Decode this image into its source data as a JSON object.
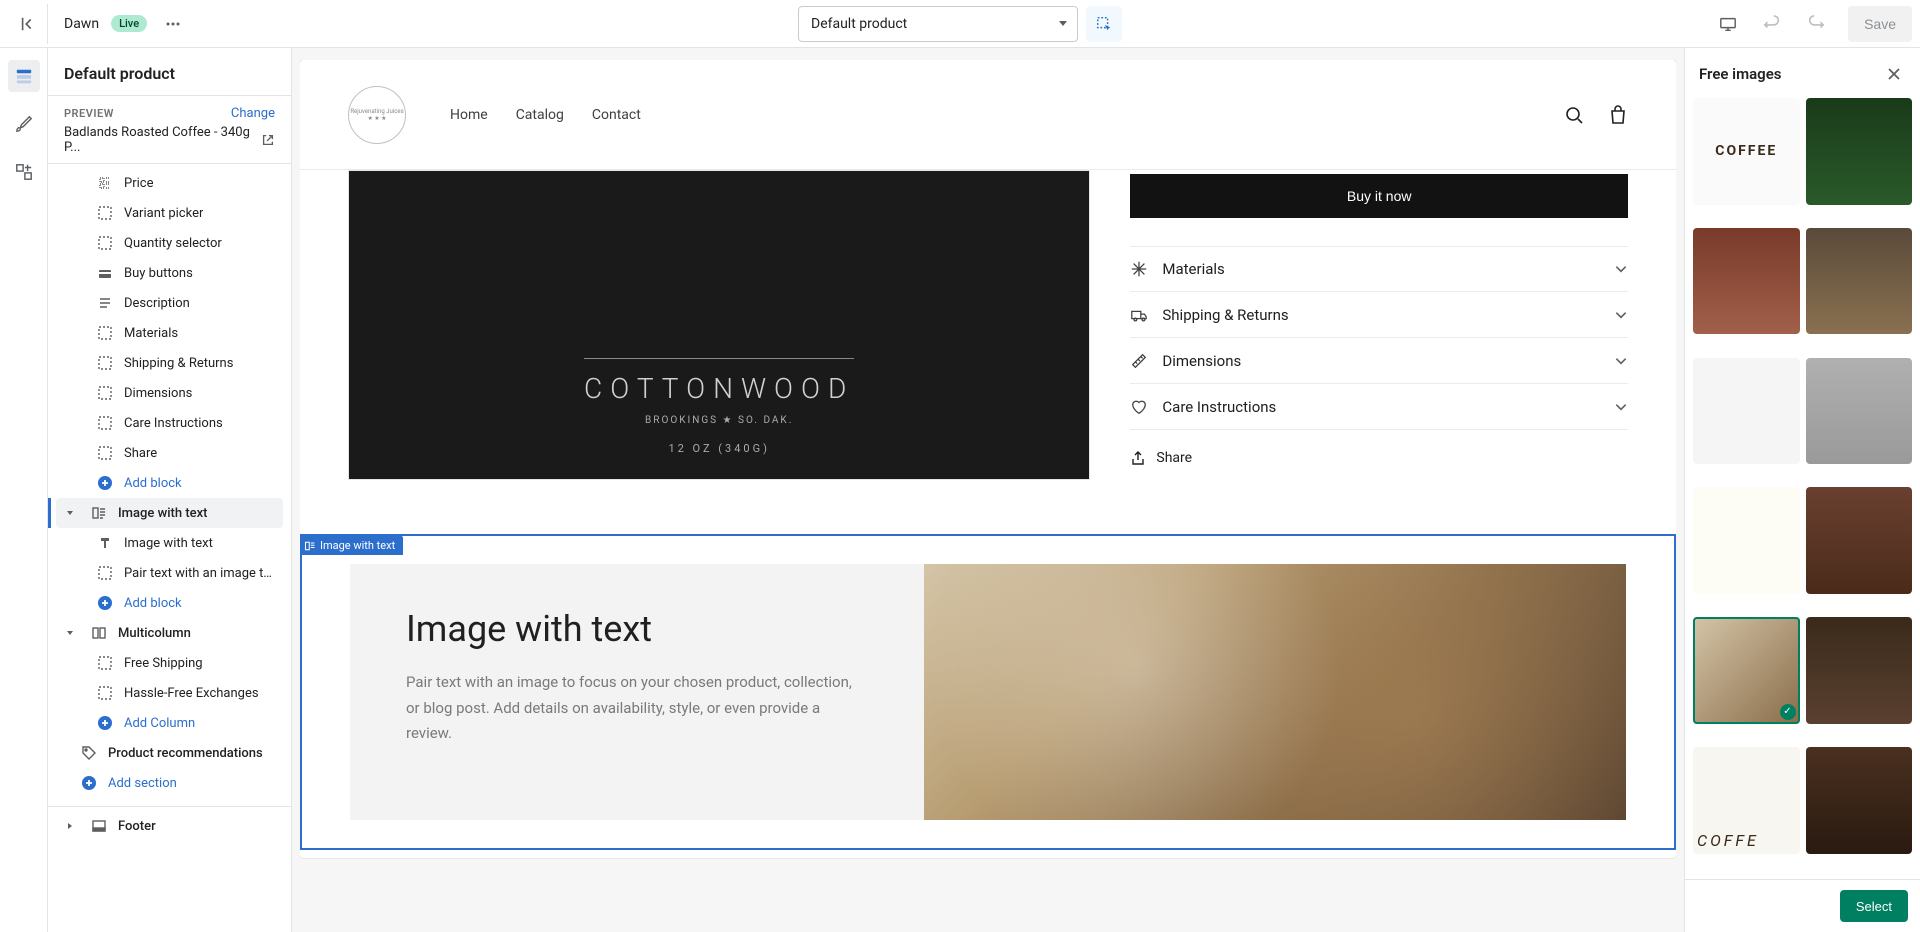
{
  "topbar": {
    "theme_name": "Dawn",
    "live_badge": "Live",
    "template_label": "Default product",
    "save_label": "Save"
  },
  "sidebar": {
    "title": "Default product",
    "preview_label": "PREVIEW",
    "change_label": "Change",
    "preview_product": "Badlands Roasted Coffee - 340g P...",
    "items": [
      {
        "label": "Price",
        "icon": "block"
      },
      {
        "label": "Variant picker",
        "icon": "block"
      },
      {
        "label": "Quantity selector",
        "icon": "block"
      },
      {
        "label": "Buy buttons",
        "icon": "buy"
      },
      {
        "label": "Description",
        "icon": "text"
      },
      {
        "label": "Materials",
        "icon": "block"
      },
      {
        "label": "Shipping & Returns",
        "icon": "block"
      },
      {
        "label": "Dimensions",
        "icon": "block"
      },
      {
        "label": "Care Instructions",
        "icon": "block"
      },
      {
        "label": "Share",
        "icon": "block"
      }
    ],
    "add_block": "Add block",
    "image_with_text": {
      "section": "Image with text",
      "children": [
        {
          "label": "Image with text",
          "icon": "heading"
        },
        {
          "label": "Pair text with an image to f...",
          "icon": "block"
        }
      ],
      "add_block": "Add block"
    },
    "multicolumn": {
      "section": "Multicolumn",
      "children": [
        {
          "label": "Free Shipping",
          "icon": "block"
        },
        {
          "label": "Hassle-Free Exchanges",
          "icon": "block"
        }
      ],
      "add_column": "Add Column"
    },
    "product_recommendations": "Product recommendations",
    "add_section": "Add section",
    "footer": "Footer"
  },
  "store": {
    "nav": [
      "Home",
      "Catalog",
      "Contact"
    ],
    "bag": {
      "brand": "COTTONWOOD",
      "loc": "BROOKINGS ★ SO. DAK.",
      "weight": "12 OZ (340G)"
    },
    "buy_label": "Buy it now",
    "accordion": [
      {
        "label": "Materials"
      },
      {
        "label": "Shipping & Returns"
      },
      {
        "label": "Dimensions"
      },
      {
        "label": "Care Instructions"
      }
    ],
    "share_label": "Share",
    "iwt_tag": "Image with text",
    "iwt": {
      "heading": "Image with text",
      "para": "Pair text with an image to focus on your chosen product, collection, or blog post. Add details on availability, style, or even provide a review."
    }
  },
  "right_panel": {
    "title": "Free images",
    "select_label": "Select"
  }
}
